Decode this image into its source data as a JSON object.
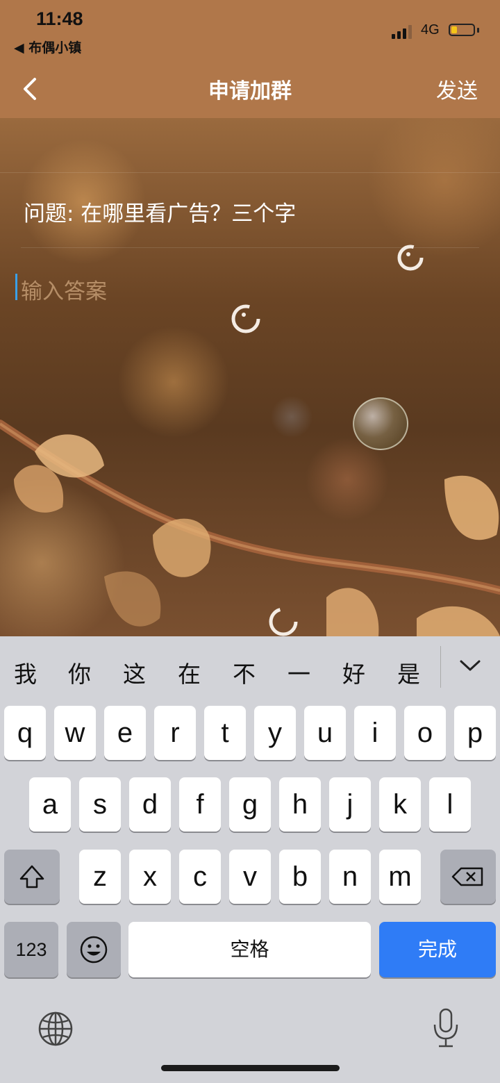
{
  "status_bar": {
    "time": "11:48",
    "back_app": "◀ 布偶小镇",
    "network": "4G",
    "battery_color": "#f5c518"
  },
  "nav": {
    "back_icon": "chevron-left-icon",
    "title": "申请加群",
    "send_label": "发送"
  },
  "form": {
    "question": "问题: 在哪里看广告？三个字",
    "answer_placeholder": "输入答案",
    "answer_value": ""
  },
  "keyboard": {
    "candidates": [
      "我",
      "你",
      "这",
      "在",
      "不",
      "一",
      "好",
      "是"
    ],
    "expand_icon": "chevron-down-icon",
    "row1": [
      "q",
      "w",
      "e",
      "r",
      "t",
      "y",
      "u",
      "i",
      "o",
      "p"
    ],
    "row2": [
      "a",
      "s",
      "d",
      "f",
      "g",
      "h",
      "j",
      "k",
      "l"
    ],
    "row3": [
      "z",
      "x",
      "c",
      "v",
      "b",
      "n",
      "m"
    ],
    "shift_icon": "shift-icon",
    "delete_icon": "backspace-icon",
    "numbers_label": "123",
    "emoji_icon": "emoji-icon",
    "space_label": "空格",
    "done_label": "完成",
    "globe_icon": "globe-icon",
    "mic_icon": "microphone-icon",
    "done_color": "#2f7cf6"
  },
  "colors": {
    "header": "#b0774a",
    "caret": "#3aa0e8"
  }
}
